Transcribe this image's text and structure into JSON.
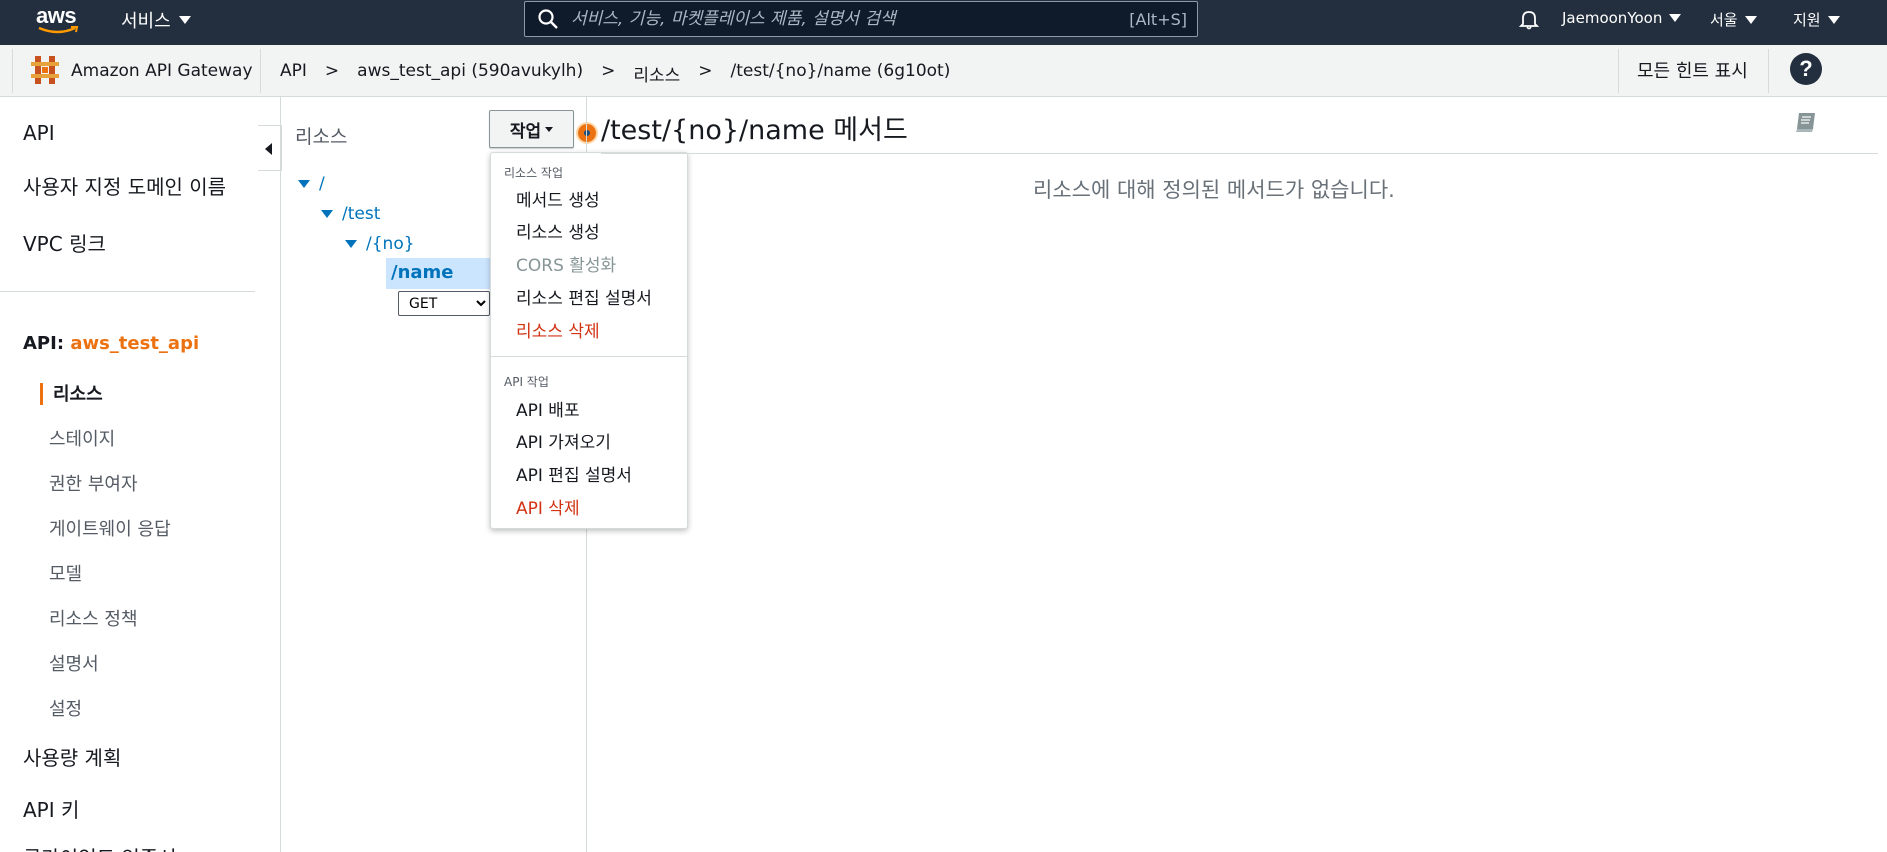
{
  "topnav": {
    "logo_text": "aws",
    "services_label": "서비스",
    "search_placeholder": "서비스, 기능, 마켓플레이스 제품, 설명서 검색",
    "search_shortcut": "[Alt+S]",
    "user_label": "JaemoonYoon",
    "region_label": "서울",
    "support_label": "지원"
  },
  "subbar": {
    "service_name": "Amazon API Gateway",
    "breadcrumbs": [
      "API",
      ">",
      "aws_test_api (590avukylh)",
      ">",
      "리소스",
      ">",
      "/test/{no}/name (6g10ot)"
    ],
    "show_hints_label": "모든 힌트 표시",
    "help_label": "?"
  },
  "sidebar": {
    "top_items": [
      "API",
      "사용자 지정 도메인 이름",
      "VPC 링크"
    ],
    "api_prefix": "API:",
    "api_name": "aws_test_api",
    "sub_items": [
      "리소스",
      "스테이지",
      "권한 부여자",
      "게이트웨이 응답",
      "모델",
      "리소스 정책",
      "설명서",
      "설정"
    ],
    "bottom_items": [
      "사용량 계획",
      "API 키",
      "클라이언트 인증서"
    ]
  },
  "resources": {
    "title": "리소스",
    "action_button": "작업",
    "tree": [
      "/",
      "/test",
      "/{no}"
    ],
    "selected": "/name",
    "method_value": "GET"
  },
  "dropdown": {
    "resource_header": "리소스 작업",
    "resource_items": [
      "메서드 생성",
      "리소스 생성",
      "CORS 활성화",
      "리소스 편집 설명서",
      "리소스 삭제"
    ],
    "api_header": "API 작업",
    "api_items": [
      "API 배포",
      "API 가져오기",
      "API 편집 설명서",
      "API 삭제"
    ]
  },
  "main": {
    "title": "/test/{no}/name 메서드",
    "empty_message": "리소스에 대해 정의된 메서드가 없습니다."
  },
  "colors": {
    "nav_bg": "#232f3e",
    "accent_orange": "#ec7211",
    "link_blue": "#0073bb",
    "danger_red": "#d13212"
  }
}
